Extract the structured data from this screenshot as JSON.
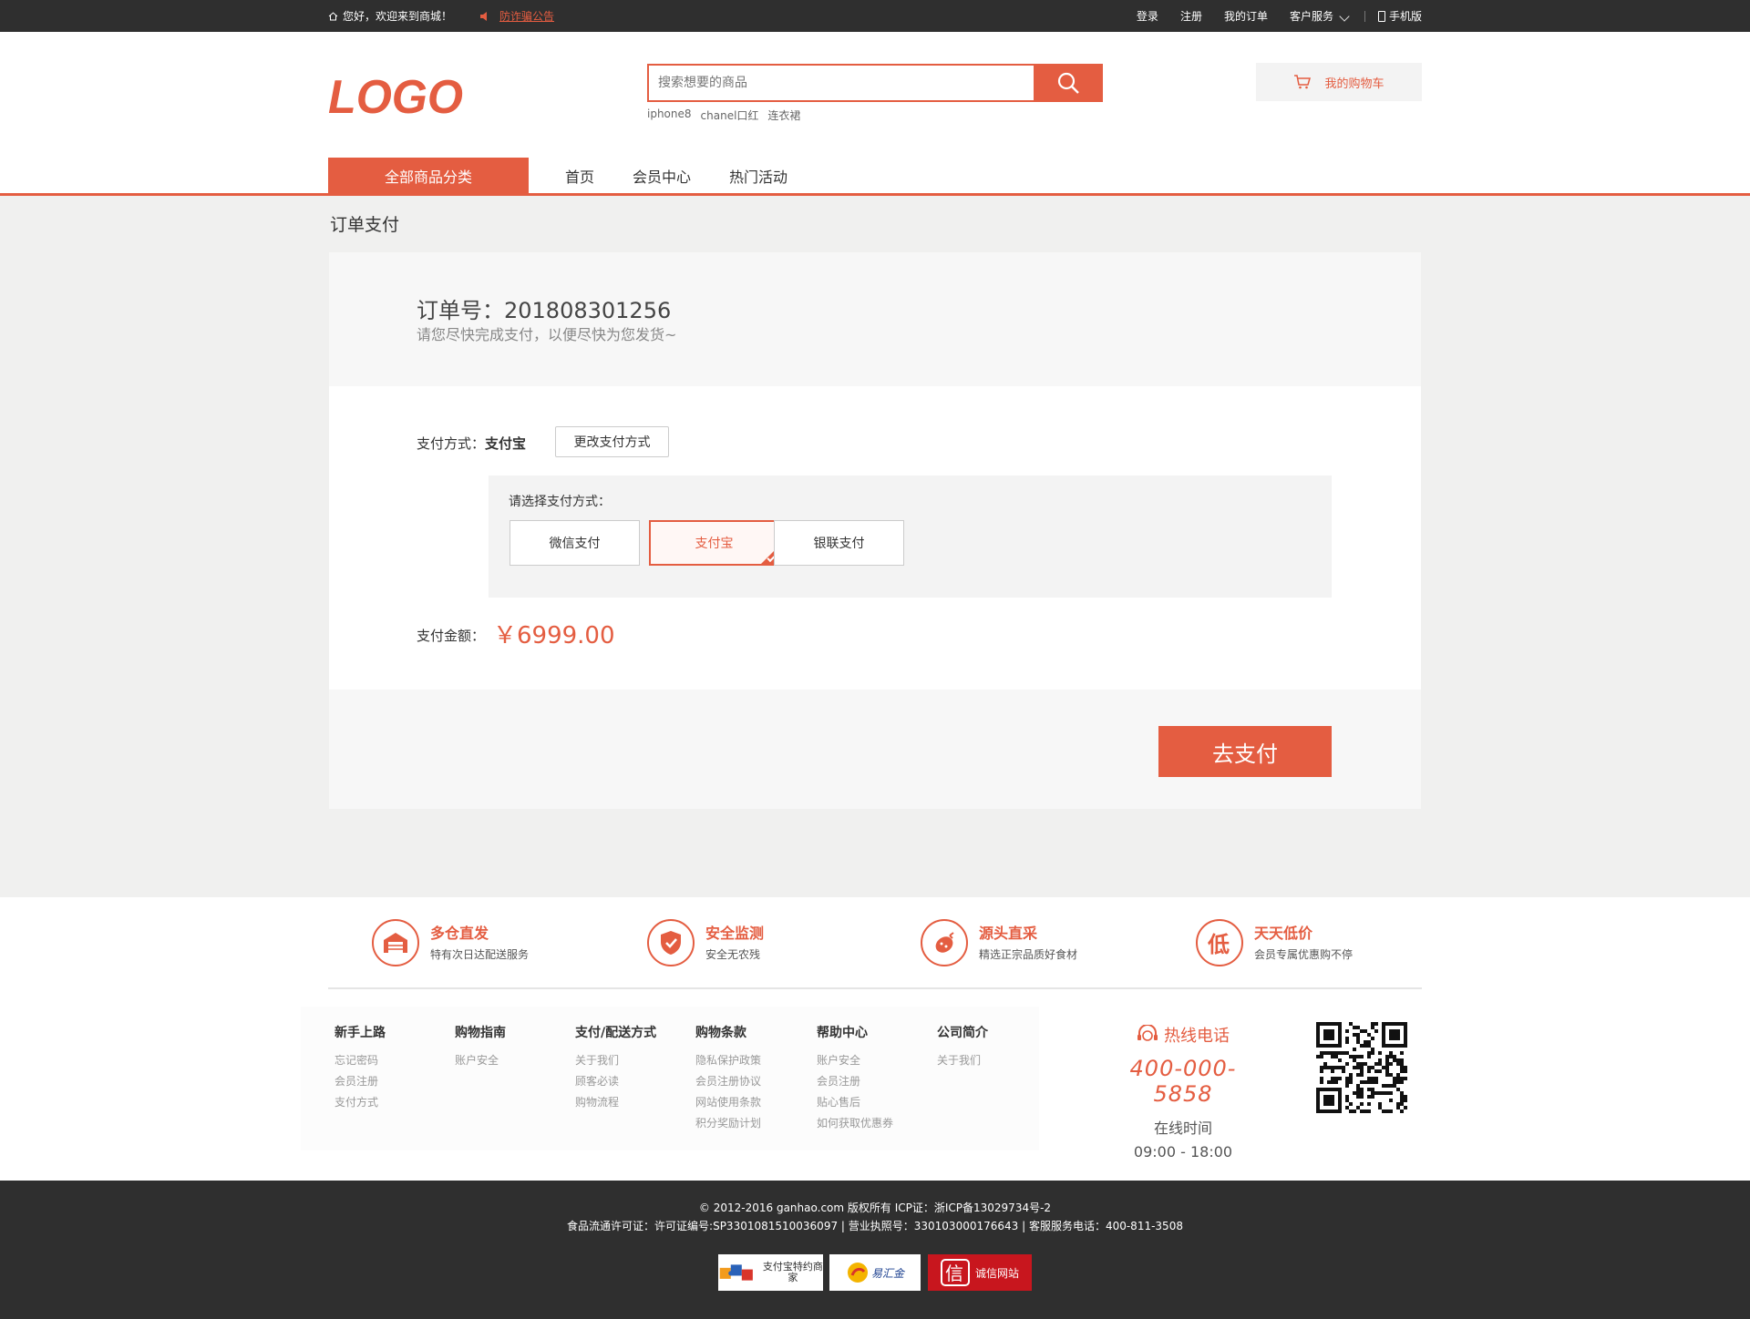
{
  "topbar": {
    "welcome": "您好，欢迎来到商城！",
    "notice": "防诈骗公告",
    "links": {
      "login": "登录",
      "register": "注册",
      "orders": "我的订单",
      "service": "客户服务",
      "mobile": "手机版"
    }
  },
  "header": {
    "logo": "LOGO",
    "search_placeholder": "搜索想要的商品",
    "hotwords": [
      "iphone8",
      "chanel口红",
      "连衣裙"
    ],
    "cart": "我的购物车"
  },
  "nav": {
    "all": "全部商品分类",
    "links": [
      "首页",
      "会员中心",
      "热门活动"
    ]
  },
  "page": {
    "title": "订单支付",
    "order_no": "订单号：201808301256",
    "tip": "请您尽快完成支付，以便尽快为您发货~",
    "pay_method_prefix": "支付方式：",
    "pay_method_value": "支付宝",
    "change_btn": "更改支付方式",
    "choose_label": "请选择支付方式：",
    "options": [
      "微信支付",
      "支付宝",
      "银联支付"
    ],
    "selected_option": "支付宝",
    "amount_label": "支付金额：",
    "amount": "￥6999.00",
    "go_pay": "去支付"
  },
  "features": [
    {
      "title": "多仓直发",
      "desc": "特有次日达配送服务",
      "icon": "warehouse-icon"
    },
    {
      "title": "安全监测",
      "desc": "安全无农残",
      "icon": "shield-check-icon"
    },
    {
      "title": "源头直采",
      "desc": "精选正宗品质好食材",
      "icon": "produce-icon"
    },
    {
      "title": "天天低价",
      "desc": "会员专属优惠购不停",
      "icon": "low-price-icon"
    }
  ],
  "footer_cols": [
    {
      "title": "新手上路",
      "items": [
        "忘记密码",
        "会员注册",
        "支付方式"
      ]
    },
    {
      "title": "购物指南",
      "items": [
        "账户安全"
      ]
    },
    {
      "title": "支付/配送方式",
      "items": [
        "关于我们",
        "顾客必读",
        "购物流程"
      ]
    },
    {
      "title": "购物条款",
      "items": [
        "隐私保护政策",
        "会员注册协议",
        "网站使用条款",
        "积分奖励计划"
      ]
    },
    {
      "title": "帮助中心",
      "items": [
        "账户安全",
        "会员注册",
        "贴心售后",
        "如何获取优惠券"
      ]
    },
    {
      "title": "公司简介",
      "items": [
        "关于我们"
      ]
    }
  ],
  "hotline": {
    "title": "热线电话",
    "number": "400-000-5858",
    "time_label": "在线时间",
    "time": "09:00 - 18:00"
  },
  "bottom": {
    "copy1": "© 2012-2016 ganhao.com 版权所有 ICP证：浙ICP备13029734号-2",
    "copy2": "食品流通许可证：许可证编号:SP3301081510036097 | 营业执照号：330103000176643 | 客服服务电话：400-811-3508",
    "badges": [
      "支付宝特约商家",
      "易汇金",
      "诚信网站"
    ]
  },
  "colors": {
    "accent": "#e45d41",
    "dark": "#2f2f2f"
  }
}
